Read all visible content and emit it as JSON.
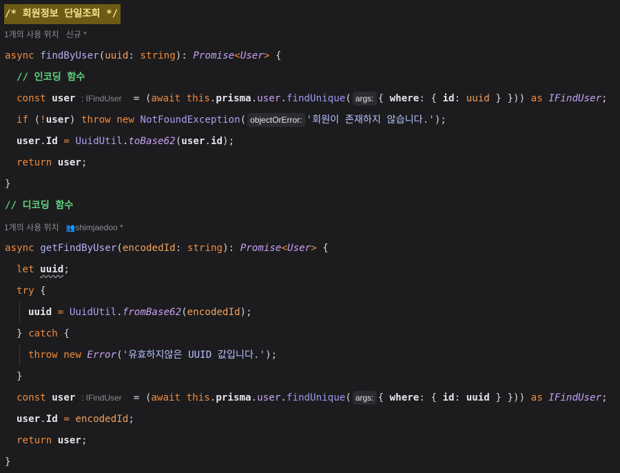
{
  "header_comment": "/* 회원정보 단일조회 */",
  "lens1": {
    "refs": "1개의 사용 위치",
    "author": "신규 *"
  },
  "lens2": {
    "refs": "1개의 사용 위치",
    "author": "shimjaedoo *"
  },
  "comments": {
    "encode": "// 인코딩 함수",
    "decode": "// 디코딩 함수"
  },
  "hints": {
    "type": ": IFindUser",
    "args": "args:",
    "objectOrError": "objectOrError:"
  },
  "strings": {
    "notFound": "'회원이 존재하지 않습니다.'",
    "invalid": "'유효하지않은 UUID 값입니다.'"
  },
  "fn1": {
    "name": "findByUser",
    "param": "uuid"
  },
  "fn2": {
    "name": "getFindByUser",
    "param": "encodedId"
  },
  "icons": {
    "author": "people-icon"
  }
}
